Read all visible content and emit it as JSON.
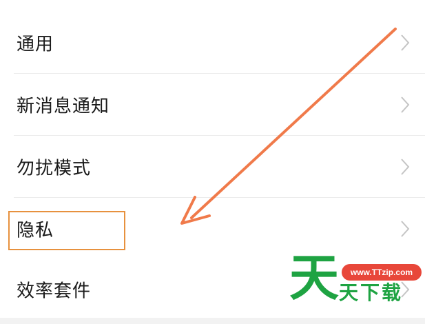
{
  "settings_list": {
    "items": [
      {
        "label": "通用"
      },
      {
        "label": "新消息通知"
      },
      {
        "label": "勿扰模式"
      },
      {
        "label": "隐私"
      },
      {
        "label": "效率套件"
      }
    ],
    "highlighted_item": "隐私"
  },
  "annotation": {
    "arrow_color": "#f07a4a",
    "highlight_color": "#e7913e"
  },
  "watermark": {
    "big_char": "天",
    "url": "www.TTzip.com",
    "name": "天下载",
    "green": "#1ea342",
    "red": "#e8473a"
  }
}
